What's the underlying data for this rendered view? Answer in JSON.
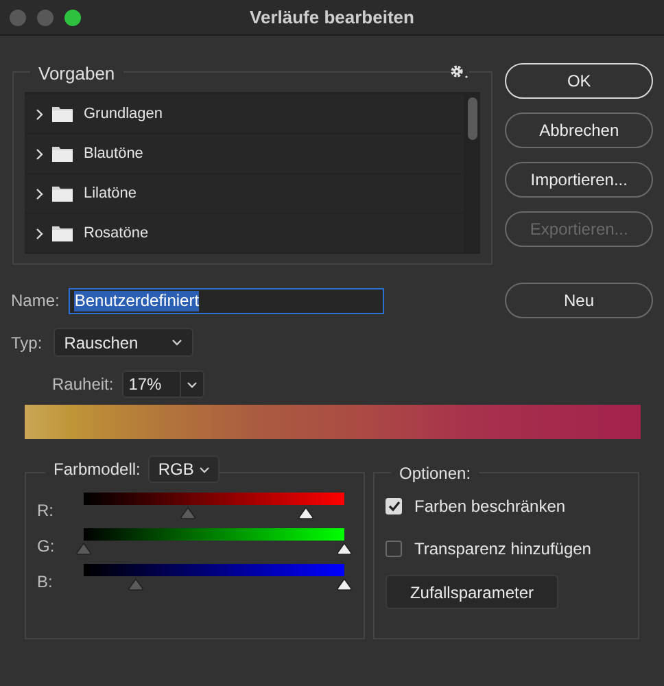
{
  "window": {
    "title": "Verläufe bearbeiten"
  },
  "presets": {
    "title": "Vorgaben",
    "items": [
      {
        "label": "Grundlagen",
        "expanded": false
      },
      {
        "label": "Blautöne",
        "expanded": false
      },
      {
        "label": "Lilatöne",
        "expanded": false
      },
      {
        "label": "Rosatöne",
        "expanded": false
      }
    ]
  },
  "buttons": [
    {
      "label": "OK",
      "default": true,
      "disabled": false
    },
    {
      "label": "Abbrechen",
      "default": false,
      "disabled": false
    },
    {
      "label": "Importieren...",
      "default": false,
      "disabled": false
    },
    {
      "label": "Exportieren...",
      "default": false,
      "disabled": true
    }
  ],
  "name": {
    "label": "Name:",
    "value": "Benutzerdefiniert"
  },
  "new_button": "Neu",
  "type": {
    "label": "Typ:",
    "value": "Rauschen"
  },
  "roughness": {
    "label": "Rauheit:",
    "value": "17%"
  },
  "color_model": {
    "label": "Farbmodell:",
    "value": "RGB",
    "channels": [
      {
        "label": "R:",
        "stops": [
          {
            "level": 0.4
          },
          {
            "level": 0.85
          }
        ]
      },
      {
        "label": "G:",
        "stops": [
          {
            "level": 0.0
          },
          {
            "level": 1.0
          }
        ]
      },
      {
        "label": "B:",
        "stops": [
          {
            "level": 0.2
          },
          {
            "level": 1.0
          }
        ]
      }
    ]
  },
  "options": {
    "title": "Optionen:",
    "checkboxes": [
      {
        "label": "Farben beschränken",
        "checked": true
      },
      {
        "label": "Transparenz hinzufügen",
        "checked": false
      }
    ],
    "randomize_button": "Zufallsparameter"
  }
}
